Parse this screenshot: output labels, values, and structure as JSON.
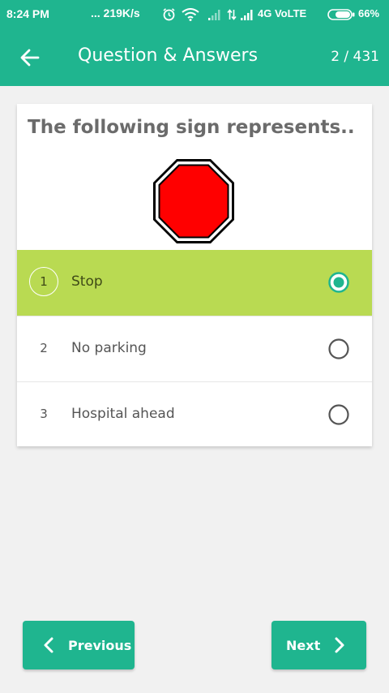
{
  "status_bar": {
    "time": "8:24 PM",
    "speed": "... 219K/s",
    "network": "4G VoLTE",
    "battery": "66%"
  },
  "app_bar": {
    "title": "Question & Answers",
    "counter": "2 / 431"
  },
  "question": {
    "text": "The following sign represents..",
    "image": "stop-sign"
  },
  "options": [
    {
      "number": "1",
      "label": "Stop",
      "selected": true
    },
    {
      "number": "2",
      "label": "No parking",
      "selected": false
    },
    {
      "number": "3",
      "label": "Hospital ahead",
      "selected": false
    }
  ],
  "nav": {
    "previous_label": "Previous",
    "next_label": "Next"
  },
  "colors": {
    "primary": "#1fb58f",
    "selected_option": "#b9da52",
    "sign_red": "#ff0000",
    "background": "#f1f1f1"
  }
}
